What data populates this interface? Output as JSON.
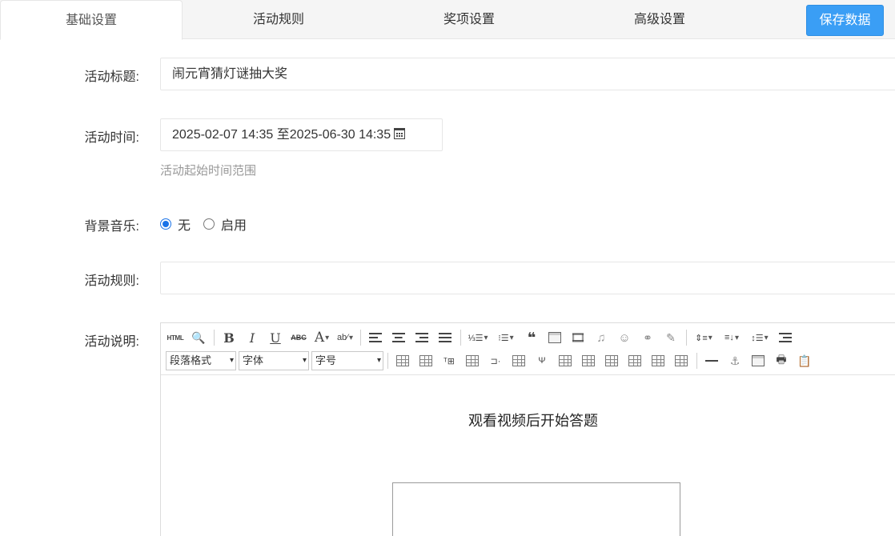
{
  "tabs": [
    {
      "label": "基础设置",
      "active": true
    },
    {
      "label": "活动规则",
      "active": false
    },
    {
      "label": "奖项设置",
      "active": false
    },
    {
      "label": "高级设置",
      "active": false
    }
  ],
  "save_button": {
    "label": "保存数据",
    "color": "#3a9ef5"
  },
  "form": {
    "title": {
      "label": "活动标题:",
      "value": "闹元宵猜灯谜抽大奖"
    },
    "time": {
      "label": "活动时间:",
      "value": "2025-02-07 14:35 至2025-06-30 14:35",
      "icon": "calendar-icon",
      "hint": "活动起始时间范围"
    },
    "music": {
      "label": "背景音乐:",
      "options": [
        {
          "label": "无",
          "checked": true
        },
        {
          "label": "启用",
          "checked": false
        }
      ]
    },
    "rules": {
      "label": "活动规则:",
      "value": ""
    },
    "description": {
      "label": "活动说明:"
    }
  },
  "editor": {
    "toolbar": {
      "paragraph_select": "段落格式",
      "font_select": "字体",
      "size_select": "字号"
    },
    "content": {
      "heading": "观看视频后开始答题"
    }
  }
}
